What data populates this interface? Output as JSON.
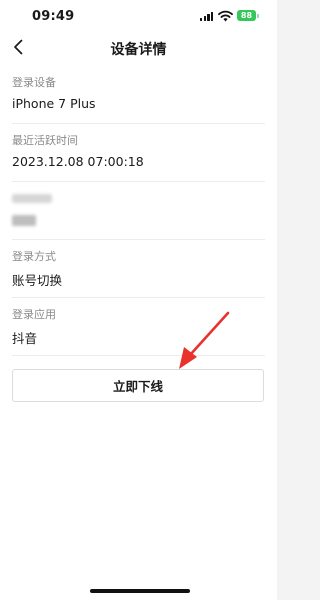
{
  "status_bar": {
    "time": "09:49",
    "battery": "88"
  },
  "nav": {
    "title": "设备详情",
    "back_icon": "chevron-left-icon"
  },
  "details": [
    {
      "label": "登录设备",
      "value": "iPhone 7 Plus"
    },
    {
      "label": "最近活跃时间",
      "value": "2023.12.08 07:00:18"
    },
    {
      "label": "",
      "value": "",
      "blurred": true
    },
    {
      "label": "登录方式",
      "value": "账号切换"
    },
    {
      "label": "登录应用",
      "value": "抖音"
    }
  ],
  "action": {
    "logout_label": "立即下线"
  },
  "colors": {
    "accent_arrow": "#e8322b",
    "battery": "#34c759",
    "label_gray": "#8a8a8a",
    "divider": "#ececec"
  }
}
